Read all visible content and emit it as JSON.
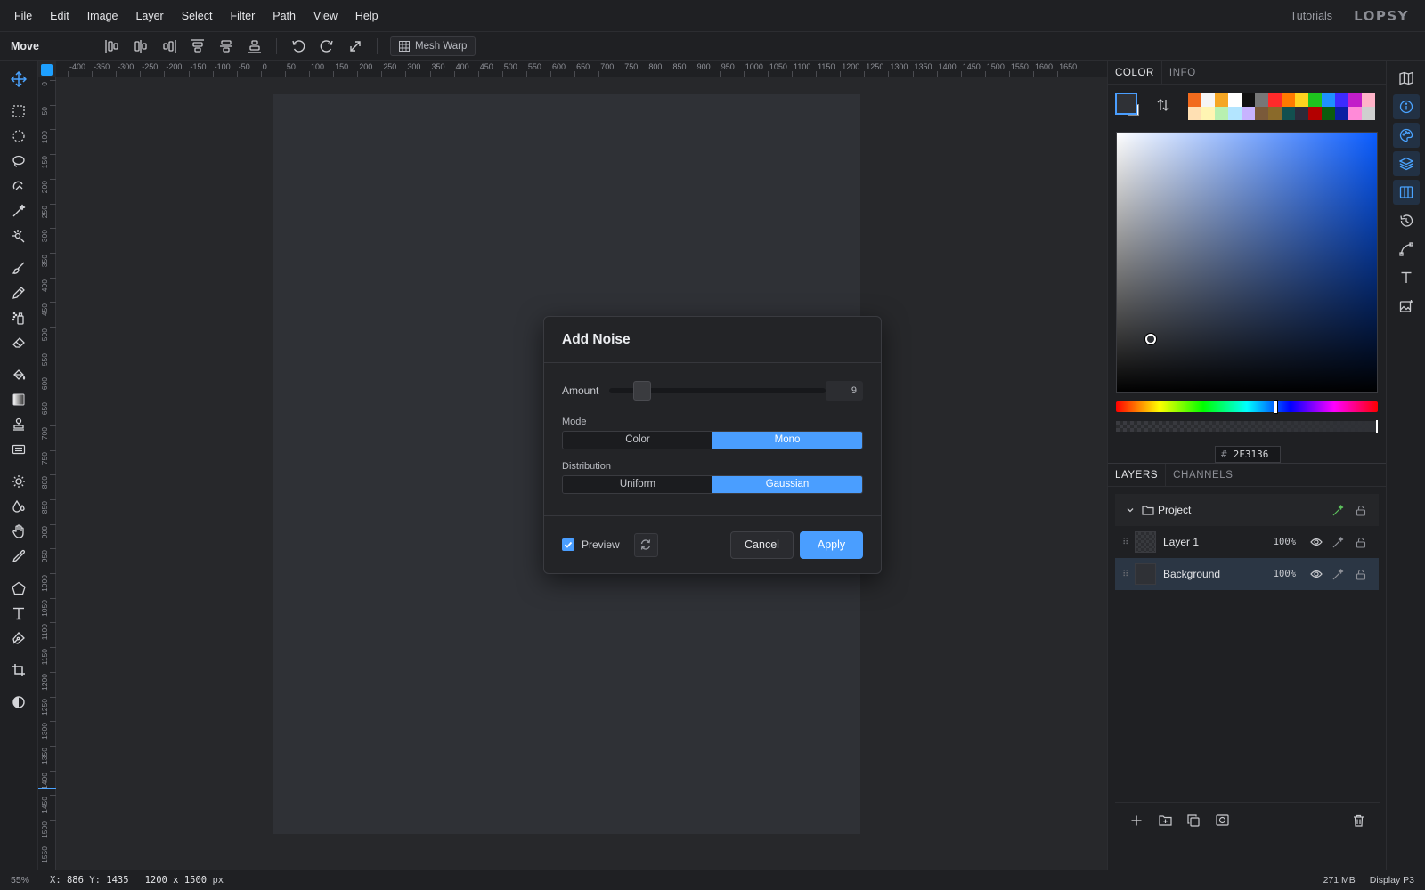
{
  "menu": [
    "File",
    "Edit",
    "Image",
    "Layer",
    "Select",
    "Filter",
    "Path",
    "View",
    "Help"
  ],
  "header": {
    "tutorials": "Tutorials",
    "logo": "LOPSY"
  },
  "options": {
    "tool_name": "Move",
    "mesh_warp": "Mesh Warp"
  },
  "rulers": {
    "top_labels": [
      "-400",
      "-350",
      "-300",
      "-250",
      "-200",
      "-150",
      "-100",
      "-50",
      "0",
      "50",
      "100",
      "150",
      "200",
      "250",
      "300",
      "350",
      "400",
      "450",
      "500",
      "550",
      "600",
      "650",
      "700",
      "750",
      "800",
      "850",
      "900",
      "950",
      "1000",
      "1050",
      "1100",
      "1150",
      "1200",
      "1250",
      "1300",
      "1350",
      "1400",
      "1450",
      "1500",
      "1550",
      "1600",
      "1650"
    ],
    "left_labels": [
      "0",
      "50",
      "100",
      "150",
      "200",
      "250",
      "300",
      "350",
      "400",
      "450",
      "500",
      "550",
      "600",
      "650",
      "700",
      "750",
      "800",
      "850",
      "900",
      "950",
      "1000",
      "1050",
      "1100",
      "1150",
      "1200",
      "1250",
      "1300",
      "1350",
      "1400",
      "1450",
      "1500",
      "1550"
    ]
  },
  "dialog": {
    "title": "Add Noise",
    "amount_label": "Amount",
    "amount_value": "9",
    "amount_fraction": 0.09,
    "mode_label": "Mode",
    "mode_options": [
      "Color",
      "Mono"
    ],
    "mode_selected": "Mono",
    "distribution_label": "Distribution",
    "distribution_options": [
      "Uniform",
      "Gaussian"
    ],
    "distribution_selected": "Gaussian",
    "preview_label": "Preview",
    "preview_checked": true,
    "cancel": "Cancel",
    "apply": "Apply"
  },
  "color_panel": {
    "tabs": [
      "COLOR",
      "INFO"
    ],
    "hex_prefix": "#",
    "hex": "2F3136",
    "foreground": "#2F3136",
    "background": "#FFFFFF",
    "hue_fraction": 0.61,
    "saturation": 0.13,
    "value": 0.21,
    "presets": [
      "#f26b1d",
      "#f5f5f5",
      "#f5a623",
      "#ffffff",
      "#111111",
      "#777777",
      "#ff2a2a",
      "#ff7a00",
      "#ffd21e",
      "#1ec31e",
      "#1e90ff",
      "#3d2bff",
      "#c21ec9",
      "#ffb3c8",
      "#ffe0b3",
      "#fff5b3",
      "#b8f0b0",
      "#b3e5ff",
      "#c7b3ff",
      "#7a5a3a",
      "#8a6a2a",
      "#124f4f",
      "#2b2b3a",
      "#b30000",
      "#0d5c0d",
      "#0a1fa3",
      "#ff8ad8",
      "#cfcfcf"
    ]
  },
  "layers_panel": {
    "tabs": [
      "LAYERS",
      "CHANNELS"
    ],
    "group": {
      "name": "Project"
    },
    "layers": [
      {
        "name": "Layer 1",
        "opacity": "100%",
        "selected": false,
        "bg": false
      },
      {
        "name": "Background",
        "opacity": "100%",
        "selected": true,
        "bg": true
      }
    ]
  },
  "status": {
    "zoom": "55%",
    "x_label": "X:",
    "x": "886",
    "y_label": "Y:",
    "y": "1435",
    "size": "1200 x 1500",
    "size_unit": "px",
    "memory": "271 MB",
    "profile": "Display P3"
  }
}
